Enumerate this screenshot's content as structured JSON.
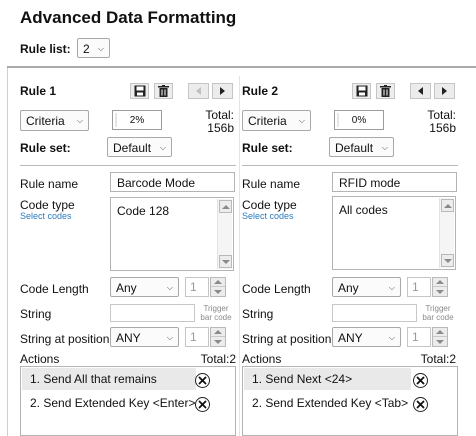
{
  "page": {
    "title": "Advanced Data Formatting"
  },
  "rule_list": {
    "label": "Rule list:",
    "value": "2"
  },
  "labels": {
    "criteria_total": "Total:",
    "rule_set": "Rule set:",
    "rule_name": "Rule name",
    "code_type": "Code type",
    "select_codes": "Select codes",
    "code_length": "Code Length",
    "string": "String",
    "trigger_line1": "Trigger",
    "trigger_line2": "bar code",
    "string_at_position": "String at position",
    "actions": "Actions"
  },
  "rules": [
    {
      "title": "Rule 1",
      "criteria": "Criteria",
      "percent": "2%",
      "total_value": "156b",
      "rule_set": "Default",
      "rule_name": "Barcode Mode",
      "code_types": [
        "Code 128"
      ],
      "code_length": "Any",
      "code_length_num": "1",
      "string": "",
      "string_position": "ANY",
      "string_position_num": "1",
      "actions_total": "Total:2",
      "actions": [
        "1. Send All that remains",
        "2. Send Extended Key <Enter>"
      ]
    },
    {
      "title": "Rule 2",
      "criteria": "Criteria",
      "percent": "0%",
      "total_value": "156b",
      "rule_set": "Default",
      "rule_name": "RFID mode",
      "code_types": [
        "All codes"
      ],
      "code_length": "Any",
      "code_length_num": "1",
      "string": "",
      "string_position": "ANY",
      "string_position_num": "1",
      "actions_total": "Total:2",
      "actions": [
        "1. Send Next <24>",
        "2. Send Extended Key <Tab>"
      ]
    }
  ]
}
